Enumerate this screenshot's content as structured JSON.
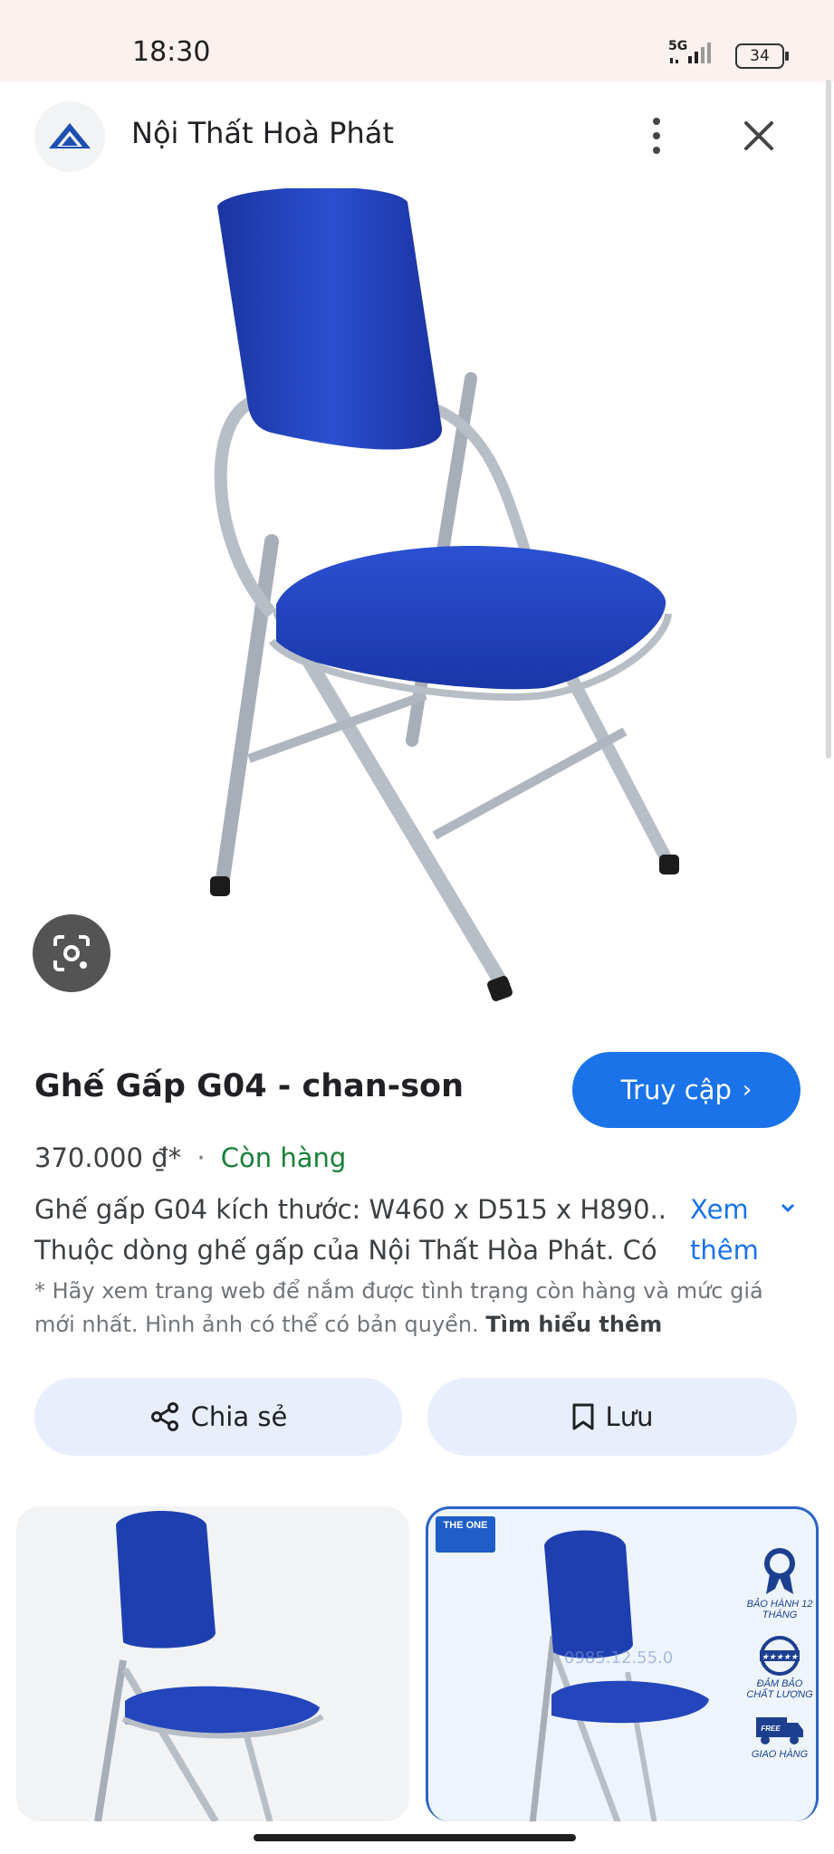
{
  "status_bar": {
    "time": "18:30",
    "network": "5G",
    "battery": "34"
  },
  "header": {
    "site_name": "Nội Thất Hoà Phát"
  },
  "product": {
    "title": "Ghế Gấp G04 - chan-son",
    "visit_label": "Truy cập",
    "price": "370.000 ₫*",
    "separator": "·",
    "availability": "Còn hàng",
    "description_lines": [
      "Ghế gấp G04 kích thước: W460 x D515 x H890....",
      "Thuộc dòng ghế gấp của Nội Thất Hòa Phát. Có"
    ],
    "more_label_line1": "Xem",
    "more_label_line2": "thêm",
    "disclaimer": "* Hãy xem trang web để nắm được tình trạng còn hàng và mức giá mới nhất. Hình ảnh có thể có bản quyền.",
    "learn_more": "Tìm hiểu thêm"
  },
  "actions": {
    "share_label": "Chia sẻ",
    "save_label": "Lưu"
  },
  "related": {
    "item2_tag": "THE ONE",
    "badges": [
      {
        "label": "BẢO HÀNH 12 THÁNG",
        "icon": "ribbon-icon"
      },
      {
        "label": "ĐẢM BẢO CHẤT LƯỢNG",
        "icon": "stars-icon"
      },
      {
        "label": "GIAO HÀNG",
        "icon": "truck-icon"
      }
    ],
    "watermark": "0985.12.55.0"
  },
  "colors": {
    "accent": "#1a73e8",
    "stock": "#188038",
    "chair_blue": "#1e3fb0",
    "frame_gray": "#b8bec6"
  }
}
